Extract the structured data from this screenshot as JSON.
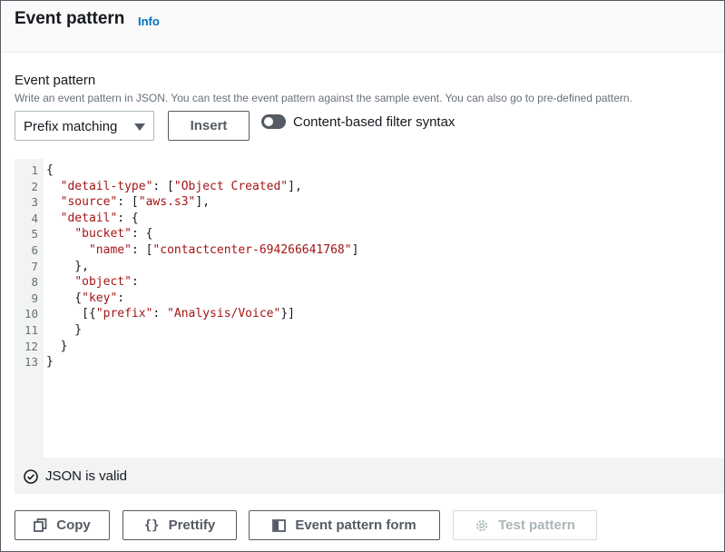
{
  "header": {
    "title": "Event pattern",
    "info_link": "Info"
  },
  "form": {
    "label": "Event pattern",
    "description": "Write an event pattern in JSON. You can test the event pattern against the sample event. You can also go to pre-defined pattern.",
    "select_value": "Prefix matching",
    "insert_button": "Insert",
    "toggle_label": "Content-based filter syntax"
  },
  "editor": {
    "line_numbers": [
      "1",
      "2",
      "3",
      "4",
      "5",
      "6",
      "7",
      "8",
      "9",
      "10",
      "11",
      "12",
      "13"
    ],
    "lines": [
      "{",
      "  \"detail-type\": [\"Object Created\"],",
      "  \"source\": [\"aws.s3\"],",
      "  \"detail\": {",
      "    \"bucket\": {",
      "      \"name\": [\"contactcenter-694266641768\"]",
      "    },",
      "    \"object\":",
      "    {\"key\":",
      "     [{\"prefix\": \"Analysis/Voice\"}]",
      "    }",
      "  }",
      "}"
    ]
  },
  "status": {
    "text": "JSON is valid"
  },
  "actions": {
    "copy": "Copy",
    "prettify": "Prettify",
    "event_pattern_form": "Event pattern form",
    "test_pattern": "Test pattern"
  }
}
